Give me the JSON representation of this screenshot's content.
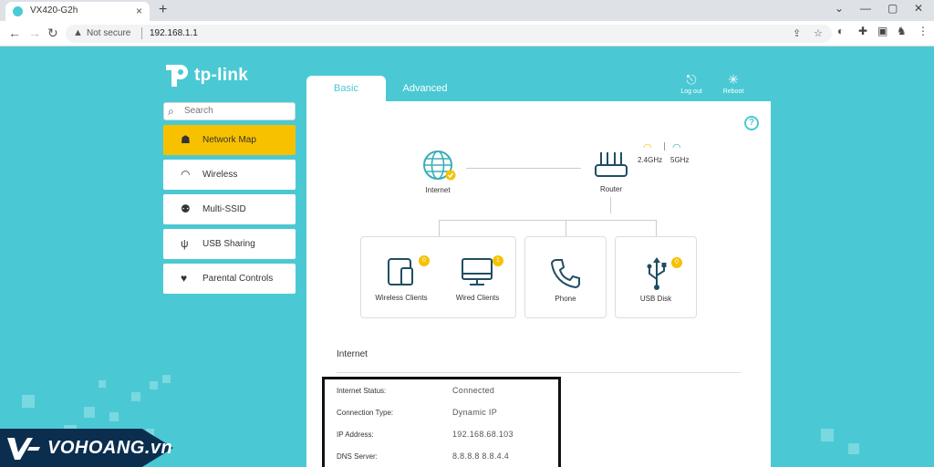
{
  "browser": {
    "tab_title": "VX420-G2h",
    "new_tab": "+",
    "security_label": "Not secure",
    "url": "192.168.1.1"
  },
  "logo": {
    "text": "tp-link"
  },
  "search": {
    "placeholder": "Search"
  },
  "sidebar": {
    "items": [
      {
        "label": "Network Map",
        "icon": "network-map-icon",
        "active": true
      },
      {
        "label": "Wireless",
        "icon": "wifi-icon",
        "active": false
      },
      {
        "label": "Multi-SSID",
        "icon": "users-icon",
        "active": false
      },
      {
        "label": "USB Sharing",
        "icon": "usb-icon",
        "active": false
      },
      {
        "label": "Parental Controls",
        "icon": "heart-icon",
        "active": false
      }
    ]
  },
  "tabs": {
    "basic": "Basic",
    "advanced": "Advanced"
  },
  "header_actions": {
    "logout": "Log out",
    "reboot": "Reboot"
  },
  "network_map": {
    "internet_label": "Internet",
    "router_label": "Router",
    "band_24": "2.4GHz",
    "band_5": "5GHz",
    "devices": [
      {
        "label": "Wireless Clients",
        "count": "0"
      },
      {
        "label": "Wired Clients",
        "count": "1"
      },
      {
        "label": "Phone",
        "count": ""
      },
      {
        "label": "USB Disk",
        "count": "0"
      }
    ]
  },
  "internet": {
    "section_title": "Internet",
    "rows": [
      {
        "key": "Internet Status:",
        "value": "Connected"
      },
      {
        "key": "Connection Type:",
        "value": "Dynamic IP"
      },
      {
        "key": "IP Address:",
        "value": "192.168.68.103"
      },
      {
        "key": "DNS Server:",
        "value": "8.8.8.8 8.8.4.4"
      }
    ]
  },
  "watermark": {
    "text": "VOHOANG.vn"
  },
  "colors": {
    "brand": "#4ac9d4",
    "active": "#f8c100",
    "watermark_bg": "#0b2e4f"
  }
}
